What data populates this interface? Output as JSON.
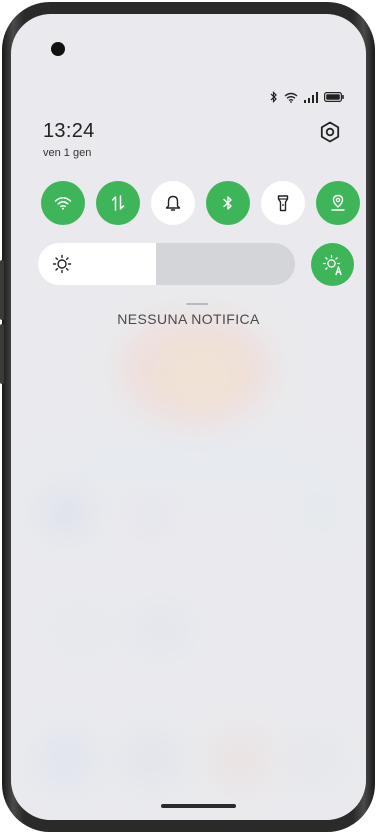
{
  "status": {
    "time": "13:24",
    "date": "ven 1 gen"
  },
  "quick_tiles": [
    {
      "id": "wifi",
      "icon": "wifi-icon",
      "state": "on"
    },
    {
      "id": "mobile-data",
      "icon": "mobile-data-icon",
      "state": "on"
    },
    {
      "id": "sound",
      "icon": "bell-icon",
      "state": "off"
    },
    {
      "id": "bluetooth",
      "icon": "bluetooth-icon",
      "state": "on"
    },
    {
      "id": "flashlight",
      "icon": "flashlight-icon",
      "state": "off"
    },
    {
      "id": "location",
      "icon": "location-icon",
      "state": "on"
    }
  ],
  "brightness": {
    "level": 0.46,
    "auto": true
  },
  "notifications": {
    "empty_label": "NESSUNA NOTIFICA"
  },
  "colors": {
    "accent": "#3fb55a",
    "tile_off": "#ffffff"
  }
}
